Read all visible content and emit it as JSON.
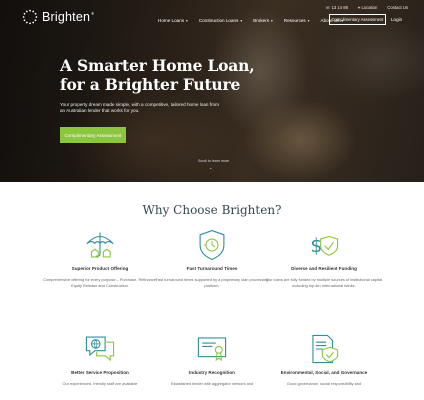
{
  "brand": {
    "name": "Brighten",
    "trademark": "®"
  },
  "topbar": {
    "phone": "13 14 88",
    "location": "Location",
    "contact": "Contact Us"
  },
  "nav": {
    "items": [
      {
        "label": "Home Loans"
      },
      {
        "label": "Construction Loans"
      },
      {
        "label": "Brokers"
      },
      {
        "label": "Resources"
      },
      {
        "label": "About Us"
      }
    ],
    "cta": "Complimentary Assessment",
    "login": "Login"
  },
  "hero": {
    "title_line1": "A Smarter Home Loan,",
    "title_line2": "for a Brighter Future",
    "subtitle": "Your property dream made simple, with a competitive, tailored home loan from an Australian lender that works for you.",
    "cta": "Complimentary Assessment",
    "scroll_hint": "Scroll to learn more"
  },
  "why": {
    "title": "Why Choose Brighten?",
    "features": [
      {
        "icon": "umbrella-icon",
        "title": "Superior Product Offering",
        "desc": "Comprehensive offering for every purpose – Purchase, Refinance, Equity Release and Construction."
      },
      {
        "icon": "shield-timer-icon",
        "title": "Fast Turnaround Times",
        "desc": "Fast turnaround times supported by a proprietary loan processing platform."
      },
      {
        "icon": "dollar-shield-icon",
        "title": "Diverse and Resilient Funding",
        "desc": "Our loans are fully funded by multiple sources of institutional capital including top-tier international banks."
      },
      {
        "icon": "chat-bubbles-icon",
        "title": "Better Service Proposition",
        "desc": "Our experienced, friendly staff are available"
      },
      {
        "icon": "certificate-icon",
        "title": "Industry Recognition",
        "desc": "Established lender with aggregator network and"
      },
      {
        "icon": "document-check-icon",
        "title": "Environmental, Social, and Governance",
        "desc": "Good governance, social responsibility and"
      }
    ]
  },
  "colors": {
    "accent": "#8cc63f",
    "heading": "#33484d",
    "icon_primary": "#2f8f9d",
    "icon_accent": "#8cc63f"
  }
}
